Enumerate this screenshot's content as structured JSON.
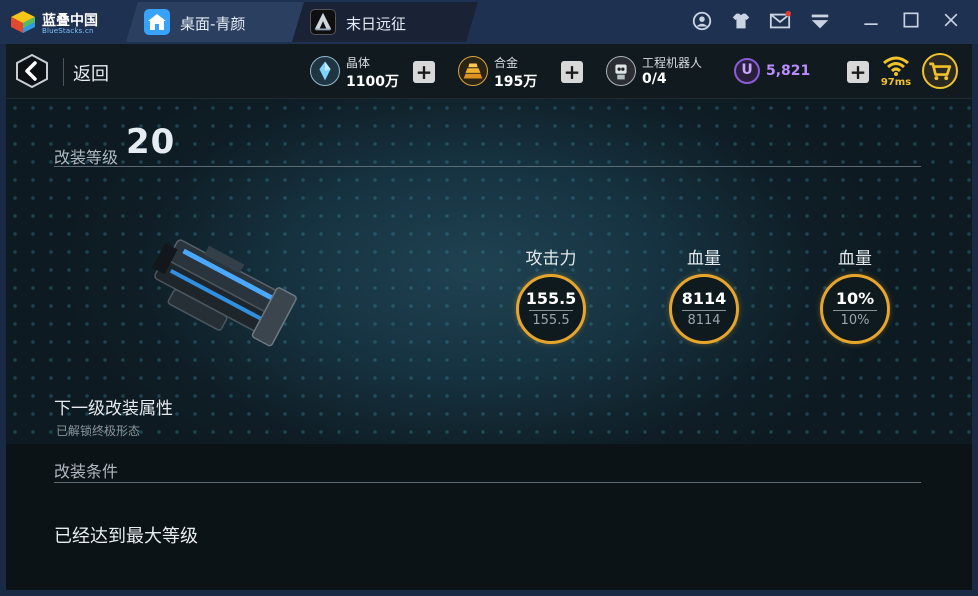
{
  "window": {
    "brand": "蓝叠中国",
    "brand_sub": "BlueStacks.cn",
    "tabs": [
      {
        "label": "桌面-青颜"
      },
      {
        "label": "末日远征"
      }
    ],
    "controls": [
      "account-icon",
      "shirt-icon",
      "mail-icon",
      "menu-icon",
      "minimize-icon",
      "maximize-icon",
      "close-icon"
    ]
  },
  "topbar": {
    "back_label": "返回",
    "resources": [
      {
        "name": "晶体",
        "value": "1100万",
        "icon": "crystal-icon"
      },
      {
        "name": "合金",
        "value": "195万",
        "icon": "alloy-icon"
      },
      {
        "name": "工程机器人",
        "value": "0/4",
        "icon": "robot-icon"
      }
    ],
    "premium_value": "5,821",
    "premium_badge": "U",
    "ping": "97ms"
  },
  "modify": {
    "level_label": "改装等级",
    "level_value": "20",
    "stats": [
      {
        "title": "攻击力",
        "current": "155.5",
        "next": "155.5"
      },
      {
        "title": "血量",
        "current": "8114",
        "next": "8114"
      },
      {
        "title": "血量",
        "current": "10%",
        "next": "10%"
      }
    ],
    "next_title": "下一级改装属性",
    "next_sub": "已解锁终极形态",
    "condition_label": "改装条件",
    "max_text": "已经达到最大等级"
  },
  "colors": {
    "accent_ring": "#e8a52c",
    "premium": "#8a5cd6",
    "ping": "#f0c22b",
    "titlebar": "#1f3150"
  }
}
